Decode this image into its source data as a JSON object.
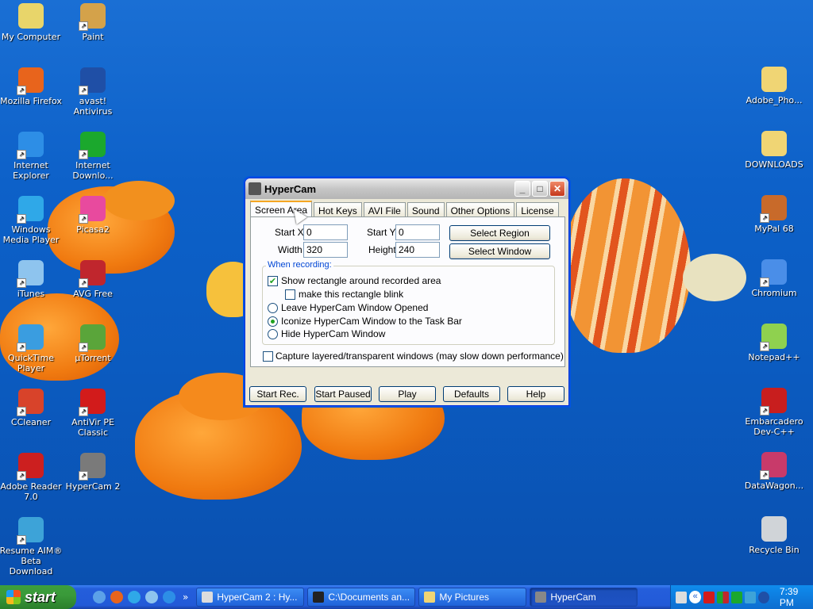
{
  "desktop_left": [
    {
      "label": "My Computer",
      "icon": "my-computer-icon",
      "color": "#e8d56a",
      "shortcut": false
    },
    {
      "label": "Paint",
      "icon": "paint-icon",
      "color": "#d4a24a",
      "shortcut": true
    },
    {
      "label": "Mozilla Firefox",
      "icon": "firefox-icon",
      "color": "#e8641c",
      "shortcut": true
    },
    {
      "label": "avast! Antivirus",
      "icon": "avast-icon",
      "color": "#1f4fa6",
      "shortcut": true
    },
    {
      "label": "Internet Explorer",
      "icon": "internet-explorer-icon",
      "color": "#2d8ee6",
      "shortcut": true
    },
    {
      "label": "Internet Downlo...",
      "icon": "internet-download-manager-icon",
      "color": "#1ba82d",
      "shortcut": true
    },
    {
      "label": "Windows Media Player",
      "icon": "windows-media-player-icon",
      "color": "#2fa8e8",
      "shortcut": true
    },
    {
      "label": "Picasa2",
      "icon": "picasa-icon",
      "color": "#e84a9e",
      "shortcut": true
    },
    {
      "label": "iTunes",
      "icon": "itunes-icon",
      "color": "#8ec4ee",
      "shortcut": true
    },
    {
      "label": "AVG Free",
      "icon": "avg-icon",
      "color": "#c0262d",
      "shortcut": true
    },
    {
      "label": "QuickTime Player",
      "icon": "quicktime-icon",
      "color": "#3a9de0",
      "shortcut": true
    },
    {
      "label": "µTorrent",
      "icon": "utorrent-icon",
      "color": "#5aa53a",
      "shortcut": true
    },
    {
      "label": "CCleaner",
      "icon": "ccleaner-icon",
      "color": "#d8432a",
      "shortcut": true
    },
    {
      "label": "AntiVir PE Classic",
      "icon": "antivir-icon",
      "color": "#d21b1b",
      "shortcut": true
    },
    {
      "label": "Adobe Reader 7.0",
      "icon": "adobe-reader-icon",
      "color": "#cc1f1f",
      "shortcut": true
    },
    {
      "label": "HyperCam 2",
      "icon": "hypercam-icon",
      "color": "#7a7a7a",
      "shortcut": true
    },
    {
      "label": "Resume AIM® Beta Download",
      "icon": "aim-icon",
      "color": "#3da3d8",
      "shortcut": true
    }
  ],
  "desktop_right": [
    {
      "label": "Adobe_Pho...",
      "icon": "zip-folder-icon",
      "color": "#f0d574",
      "shortcut": false
    },
    {
      "label": "DOWNLOADS",
      "icon": "folder-icon",
      "color": "#f0d574",
      "shortcut": false
    },
    {
      "label": "MyPal 68",
      "icon": "mypal-icon",
      "color": "#c86a2a",
      "shortcut": true
    },
    {
      "label": "Chromium",
      "icon": "chromium-icon",
      "color": "#4a8ee8",
      "shortcut": true
    },
    {
      "label": "Notepad++",
      "icon": "notepad-plus-plus-icon",
      "color": "#8fd14f",
      "shortcut": true
    },
    {
      "label": "Embarcadero Dev-C++",
      "icon": "dev-cpp-icon",
      "color": "#c81e1e",
      "shortcut": true
    },
    {
      "label": "DataWagon...",
      "icon": "datawagon-icon",
      "color": "#c83a6a",
      "shortcut": true
    },
    {
      "label": "Recycle Bin",
      "icon": "recycle-bin-icon",
      "color": "#d0d4d8",
      "shortcut": false
    }
  ],
  "window": {
    "title": "HyperCam",
    "tabs": [
      "Screen Area",
      "Hot Keys",
      "AVI File",
      "Sound",
      "Other Options",
      "License"
    ],
    "active_tab": "Screen Area",
    "start_x_label": "Start X",
    "start_x_value": "0",
    "start_y_label": "Start Y",
    "start_y_value": "0",
    "width_label": "Width",
    "width_value": "320",
    "height_label": "Height",
    "height_value": "240",
    "select_region": "Select Region",
    "select_window": "Select Window",
    "group_title": "When recording:",
    "opt_show_rect": "Show rectangle around recorded area",
    "opt_show_rect_checked": true,
    "opt_blink": "make this rectangle blink",
    "opt_blink_checked": false,
    "radio_leave": "Leave HyperCam Window Opened",
    "radio_iconize": "Iconize HyperCam Window to the Task Bar",
    "radio_hide": "Hide HyperCam Window",
    "radio_selected": "Iconize HyperCam Window to the Task Bar",
    "opt_layered": "Capture layered/transparent windows (may slow down performance)",
    "opt_layered_checked": false,
    "buttons": [
      "Start Rec.",
      "Start Paused",
      "Play",
      "Defaults",
      "Help"
    ]
  },
  "taskbar": {
    "start_label": "start",
    "tasks": [
      {
        "label": "HyperCam 2 : Hy...",
        "active": false
      },
      {
        "label": "C:\\Documents an...",
        "active": false
      },
      {
        "label": "My Pictures",
        "active": false
      },
      {
        "label": "HyperCam",
        "active": true
      }
    ],
    "clock": "7:39 PM",
    "overflow_chevron": "«"
  }
}
